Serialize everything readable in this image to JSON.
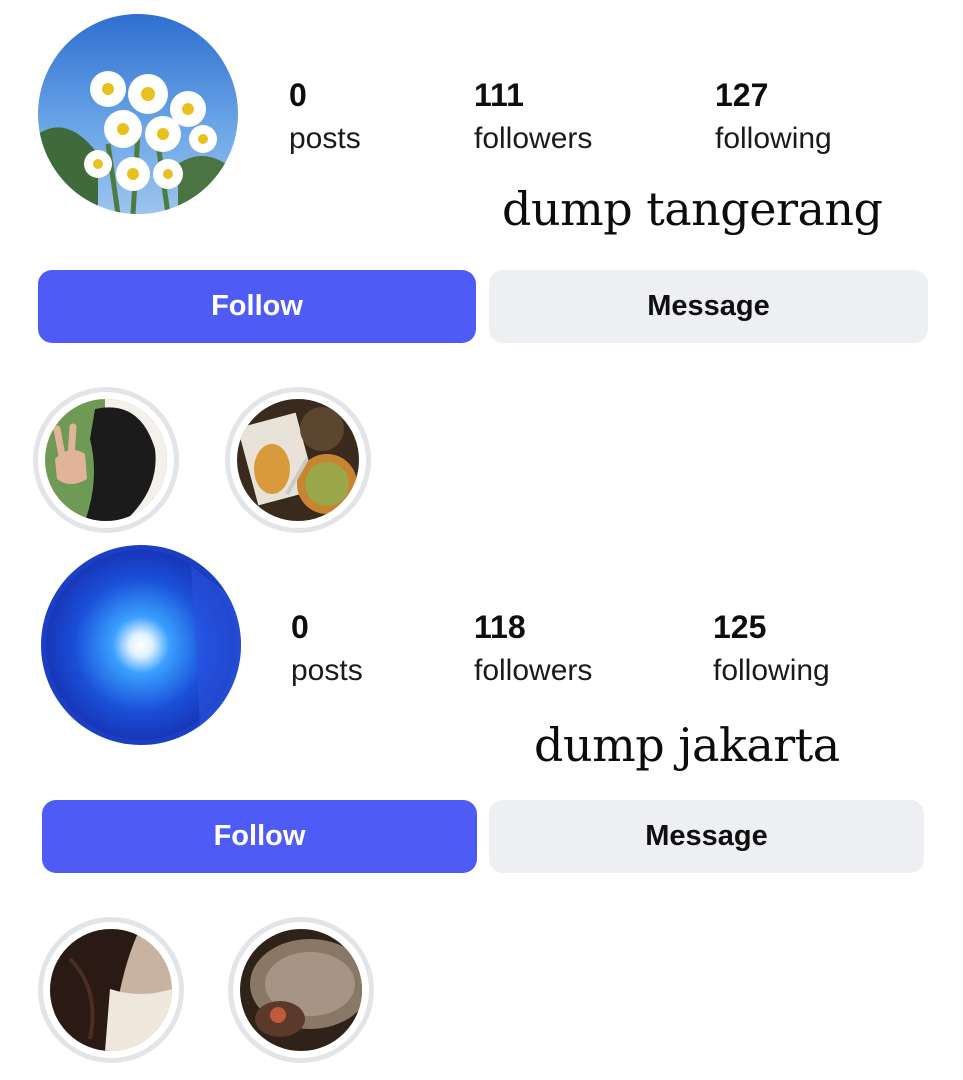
{
  "profiles": [
    {
      "stats": [
        {
          "num": "0",
          "label": "posts"
        },
        {
          "num": "111",
          "label": "followers"
        },
        {
          "num": "127",
          "label": "following"
        }
      ],
      "handle": "dump tangerang",
      "follow_label": "Follow",
      "message_label": "Message",
      "avatar": "daisy-flowers-photo",
      "highlights": [
        "peace-sign-girl-photo",
        "food-plate-photo"
      ]
    },
    {
      "stats": [
        {
          "num": "0",
          "label": "posts"
        },
        {
          "num": "118",
          "label": "followers"
        },
        {
          "num": "125",
          "label": "following"
        }
      ],
      "handle": "dump jakarta",
      "follow_label": "Follow",
      "message_label": "Message",
      "avatar": "blue-light-photo",
      "highlights": [
        "dark-hair-girl-photo",
        "brown-dish-photo"
      ]
    }
  ],
  "colors": {
    "follow_bg": "#4f5bf5",
    "message_bg": "#eeeff2",
    "highlight_ring": "#e3e4e8"
  }
}
